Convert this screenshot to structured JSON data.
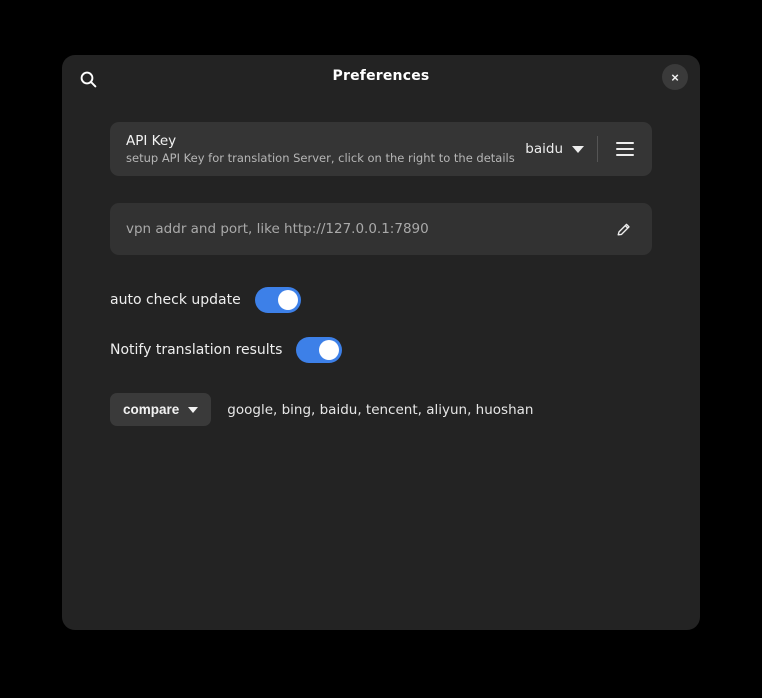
{
  "window": {
    "title": "Preferences",
    "search_icon": "search-icon",
    "close_label": "×"
  },
  "api_key": {
    "title": "API Key",
    "subtitle": "setup API Key for translation Server, click on the right to the details",
    "selected_engine": "baidu",
    "chevron_icon": "chevron-down-icon",
    "menu_icon": "hamburger-menu-icon"
  },
  "vpn": {
    "value": "",
    "placeholder": "vpn addr and port, like http://127.0.0.1:7890",
    "edit_icon": "pencil-icon"
  },
  "settings": {
    "auto_check_update": {
      "label": "auto check update",
      "state": "on"
    },
    "notify_translation_results": {
      "label": "Notify translation results",
      "state": "on"
    }
  },
  "compare": {
    "button_label": "compare",
    "chevron_icon": "chevron-down-icon",
    "engines": "google, bing, baidu, tencent, aliyun, huoshan"
  },
  "colors": {
    "page_background": "#000000",
    "window_background": "#232323",
    "card_background": "#353535",
    "field_background": "#323232",
    "accent_blue": "#3d80e8",
    "text_primary": "#f2f2f2",
    "text_secondary": "#b6b6b6"
  }
}
